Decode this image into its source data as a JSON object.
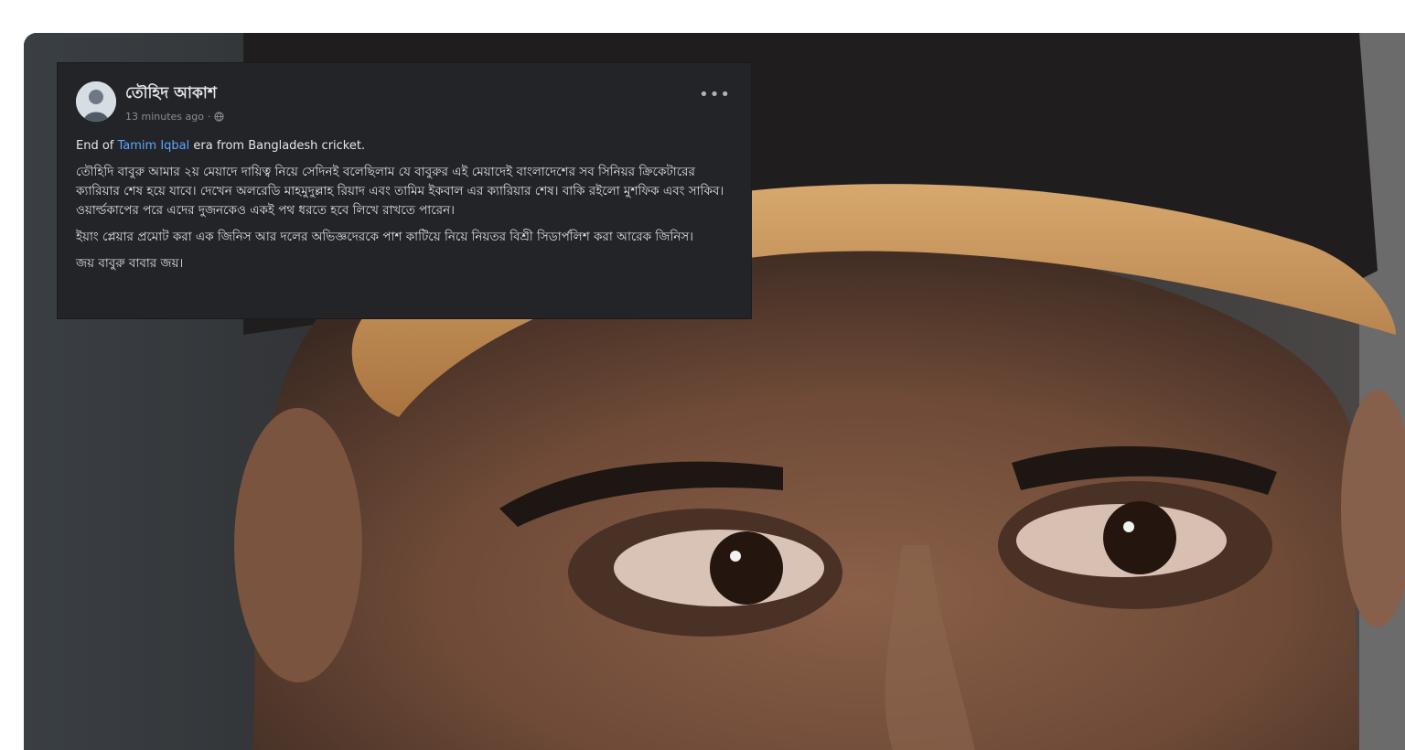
{
  "post": {
    "author": "তৌহিদ আকাশ",
    "timestamp": "13 minutes ago",
    "audience_icon": "globe-icon",
    "more_icon": "more-options-icon",
    "intro_prefix": "End of ",
    "tagged_name": "Tamim Iqbal",
    "intro_suffix": " era from Bangladesh cricket.",
    "paragraph_1": "তৌহিদি বাবুরু আমার ২য় মেয়াদে দায়িত্ব নিয়ে সেদিনই বলেছিলাম যে বাবুরুর এই মেয়াদেই বাংলাদেশের সব সিনিয়র ক্রিকেটারের ক্যারিয়ার শেষ হয়ে যাবে। দেখেন অলরেডি মাহমুদুল্লাহ রিয়াদ এবং তামিম ইকবাল এর ক্যারিয়ার শেষ। বাকি রইলো মুশফিক এবং সাকিব। ওয়ার্ল্ডকাপের পরে এদের দুজনকেও একই পথ ধরতে হবে লিখে রাখতে পারেন।",
    "paragraph_2": "ইয়াং প্লেয়ার প্রমোট করা এক জিনিস আর দলের অভিজ্ঞদেরকে পাশ কাটিয়ে নিয়ে নিয়তর বিশ্রী সিডার্পলিশ করা আরেক জিনিস।",
    "paragraph_3": "জয় বাবুরু বাবার জয়।"
  },
  "colors": {
    "card_bg": "#232427",
    "link": "#5aa7ff",
    "cap_orange": "#c9955a",
    "cap_dark": "#1f1d1d"
  }
}
